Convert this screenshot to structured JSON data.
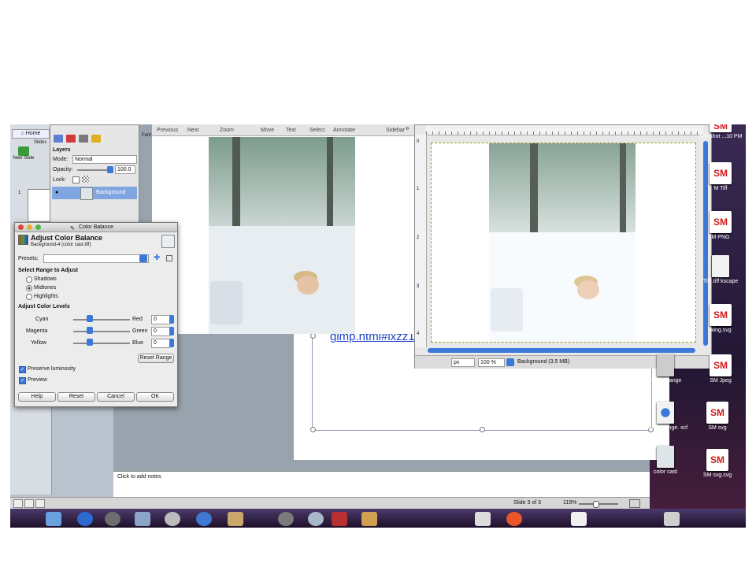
{
  "ppt": {
    "home_tab": "Home",
    "slides_label": "Slides",
    "new_slide": "New Slide",
    "slide_number": "1",
    "link_text": "gimp.html#ixzz1n8ATPBLI",
    "notes_placeholder": "Click to add notes",
    "status_slide": "Slide 3 of 3",
    "zoom": "119%"
  },
  "preview": {
    "toolbar": [
      "Previous",
      "Next",
      "Zoom",
      "Move",
      "Text",
      "Select",
      "Annotate",
      "Sidebar"
    ]
  },
  "layers": {
    "font_tab": "Font",
    "title": "Layers",
    "mode_label": "Mode:",
    "mode_value": "Normal",
    "opacity_label": "Opacity:",
    "opacity_value": "100.0",
    "lock_label": "Lock:",
    "layer_name": "Background"
  },
  "color_balance": {
    "window_title": "Color Balance",
    "heading": "Adjust Color Balance",
    "subheading": "Background-4 (color cast.tiff)",
    "presets_label": "Presets:",
    "range_heading": "Select Range to Adjust",
    "ranges": [
      "Shadows",
      "Midtones",
      "Highlights"
    ],
    "levels_heading": "Adjust Color Levels",
    "rows": [
      {
        "left": "Cyan",
        "right": "Red",
        "value": "0"
      },
      {
        "left": "Magenta",
        "right": "Green",
        "value": "0"
      },
      {
        "left": "Yellow",
        "right": "Blue",
        "value": "0"
      }
    ],
    "reset_range": "Reset Range",
    "preserve_luminosity": "Preserve luminosity",
    "preview": "Preview",
    "buttons": {
      "help": "Help",
      "reset": "Reset",
      "cancel": "Cancel",
      "ok": "OK"
    }
  },
  "gimp": {
    "unit": "px",
    "zoom": "100 %",
    "layer_info": "Background (3.5 MB)",
    "ruler_left": [
      "0",
      "1",
      "2",
      "3",
      "4"
    ]
  },
  "desktop": {
    "icons": [
      {
        "label": "een shot ...10 PM",
        "badge": "SM"
      },
      {
        "label": "M Tiff",
        "badge": "SM"
      },
      {
        "label": "M PNG",
        "badge": "SM"
      },
      {
        "label": "Tiff .tiff kscape",
        "badge": ""
      },
      {
        "label": "wing.svg",
        "badge": "SM"
      },
      {
        "label": "SM Jpeg",
        "badge": "SM"
      },
      {
        "label": "RGB-Orange",
        "badge": ""
      },
      {
        "label": "GBraworange. xcf",
        "badge": ""
      },
      {
        "label": "SM svg",
        "badge": "SM"
      },
      {
        "label": "color cast",
        "badge": ""
      },
      {
        "label": "SM svg.svg",
        "badge": "SM"
      }
    ]
  },
  "colors": {
    "accent": "#3b78d8",
    "link": "#1a3fc7",
    "sm_red": "#d01a1a"
  }
}
